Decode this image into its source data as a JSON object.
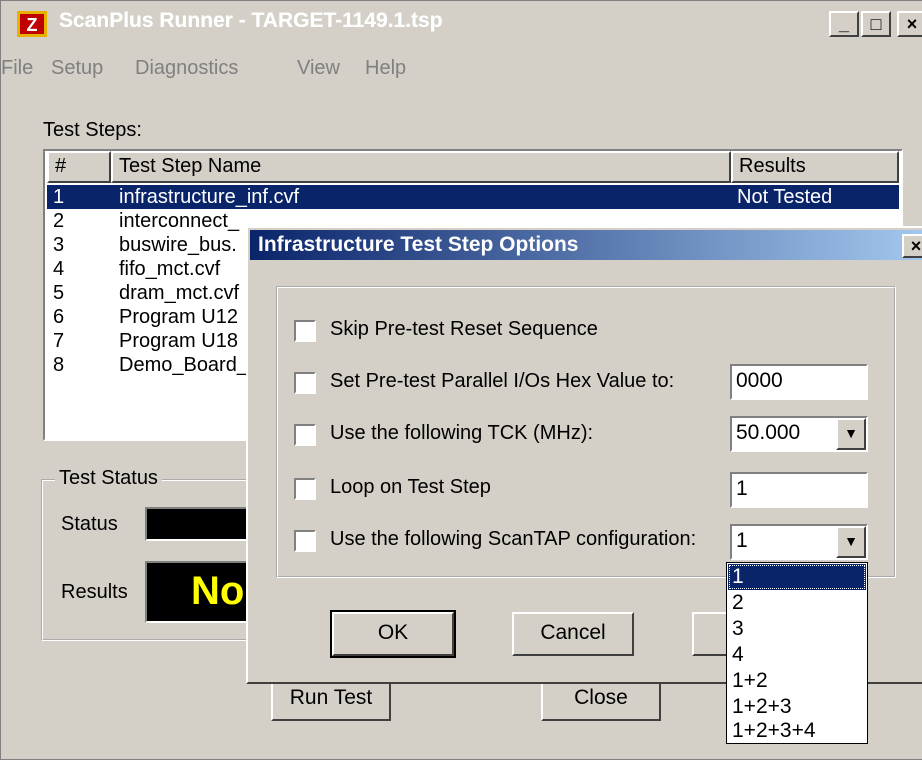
{
  "window": {
    "title": "ScanPlus Runner - TARGET-1149.1.tsp",
    "controls": {
      "minimize": "_",
      "maximize": "□",
      "close": "×"
    }
  },
  "menu": {
    "file": "File",
    "setup": "Setup",
    "diagnostics": "Diagnostics",
    "view": "View",
    "help": "Help"
  },
  "test_steps": {
    "label": "Test Steps:",
    "columns": {
      "num": "#",
      "name": "Test Step Name",
      "results": "Results"
    },
    "rows": [
      {
        "num": "1",
        "name": "infrastructure_inf.cvf",
        "result": "Not Tested"
      },
      {
        "num": "2",
        "name": "interconnect_",
        "result": ""
      },
      {
        "num": "3",
        "name": "buswire_bus.",
        "result": ""
      },
      {
        "num": "4",
        "name": "fifo_mct.cvf",
        "result": ""
      },
      {
        "num": "5",
        "name": "dram_mct.cvf",
        "result": ""
      },
      {
        "num": "6",
        "name": "Program U12",
        "result": ""
      },
      {
        "num": "7",
        "name": "Program U18",
        "result": ""
      },
      {
        "num": "8",
        "name": "Demo_Board_",
        "result": ""
      }
    ]
  },
  "test_status": {
    "group_label": "Test Status",
    "status_label": "Status",
    "results_label": "Results",
    "results_value": "No"
  },
  "main_buttons": {
    "run_test": "Run Test",
    "close": "Close"
  },
  "dialog": {
    "title": "Infrastructure Test Step Options",
    "close": "×",
    "options": {
      "skip_reset": "Skip Pre-test Reset Sequence",
      "parallel_io": "Set Pre-test Parallel I/Os Hex Value to:",
      "tck": "Use the following TCK (MHz):",
      "loop": "Loop on Test Step",
      "scantap": "Use the following ScanTAP configuration:"
    },
    "values": {
      "parallel_io": "0000",
      "tck": "50.000",
      "loop": "1",
      "scantap": "1"
    },
    "scantap_options": [
      "1",
      "2",
      "3",
      "4",
      "1+2",
      "1+2+3",
      "1+2+3+4"
    ],
    "buttons": {
      "ok": "OK",
      "cancel": "Cancel"
    }
  },
  "colors": {
    "face": "#d4d0c8",
    "selection": "#0a246a",
    "results_text": "#ffff00",
    "results_bg": "#000000"
  },
  "icons": {
    "app": "scanplus-app-icon",
    "dropdown": "chevron-down-icon"
  }
}
